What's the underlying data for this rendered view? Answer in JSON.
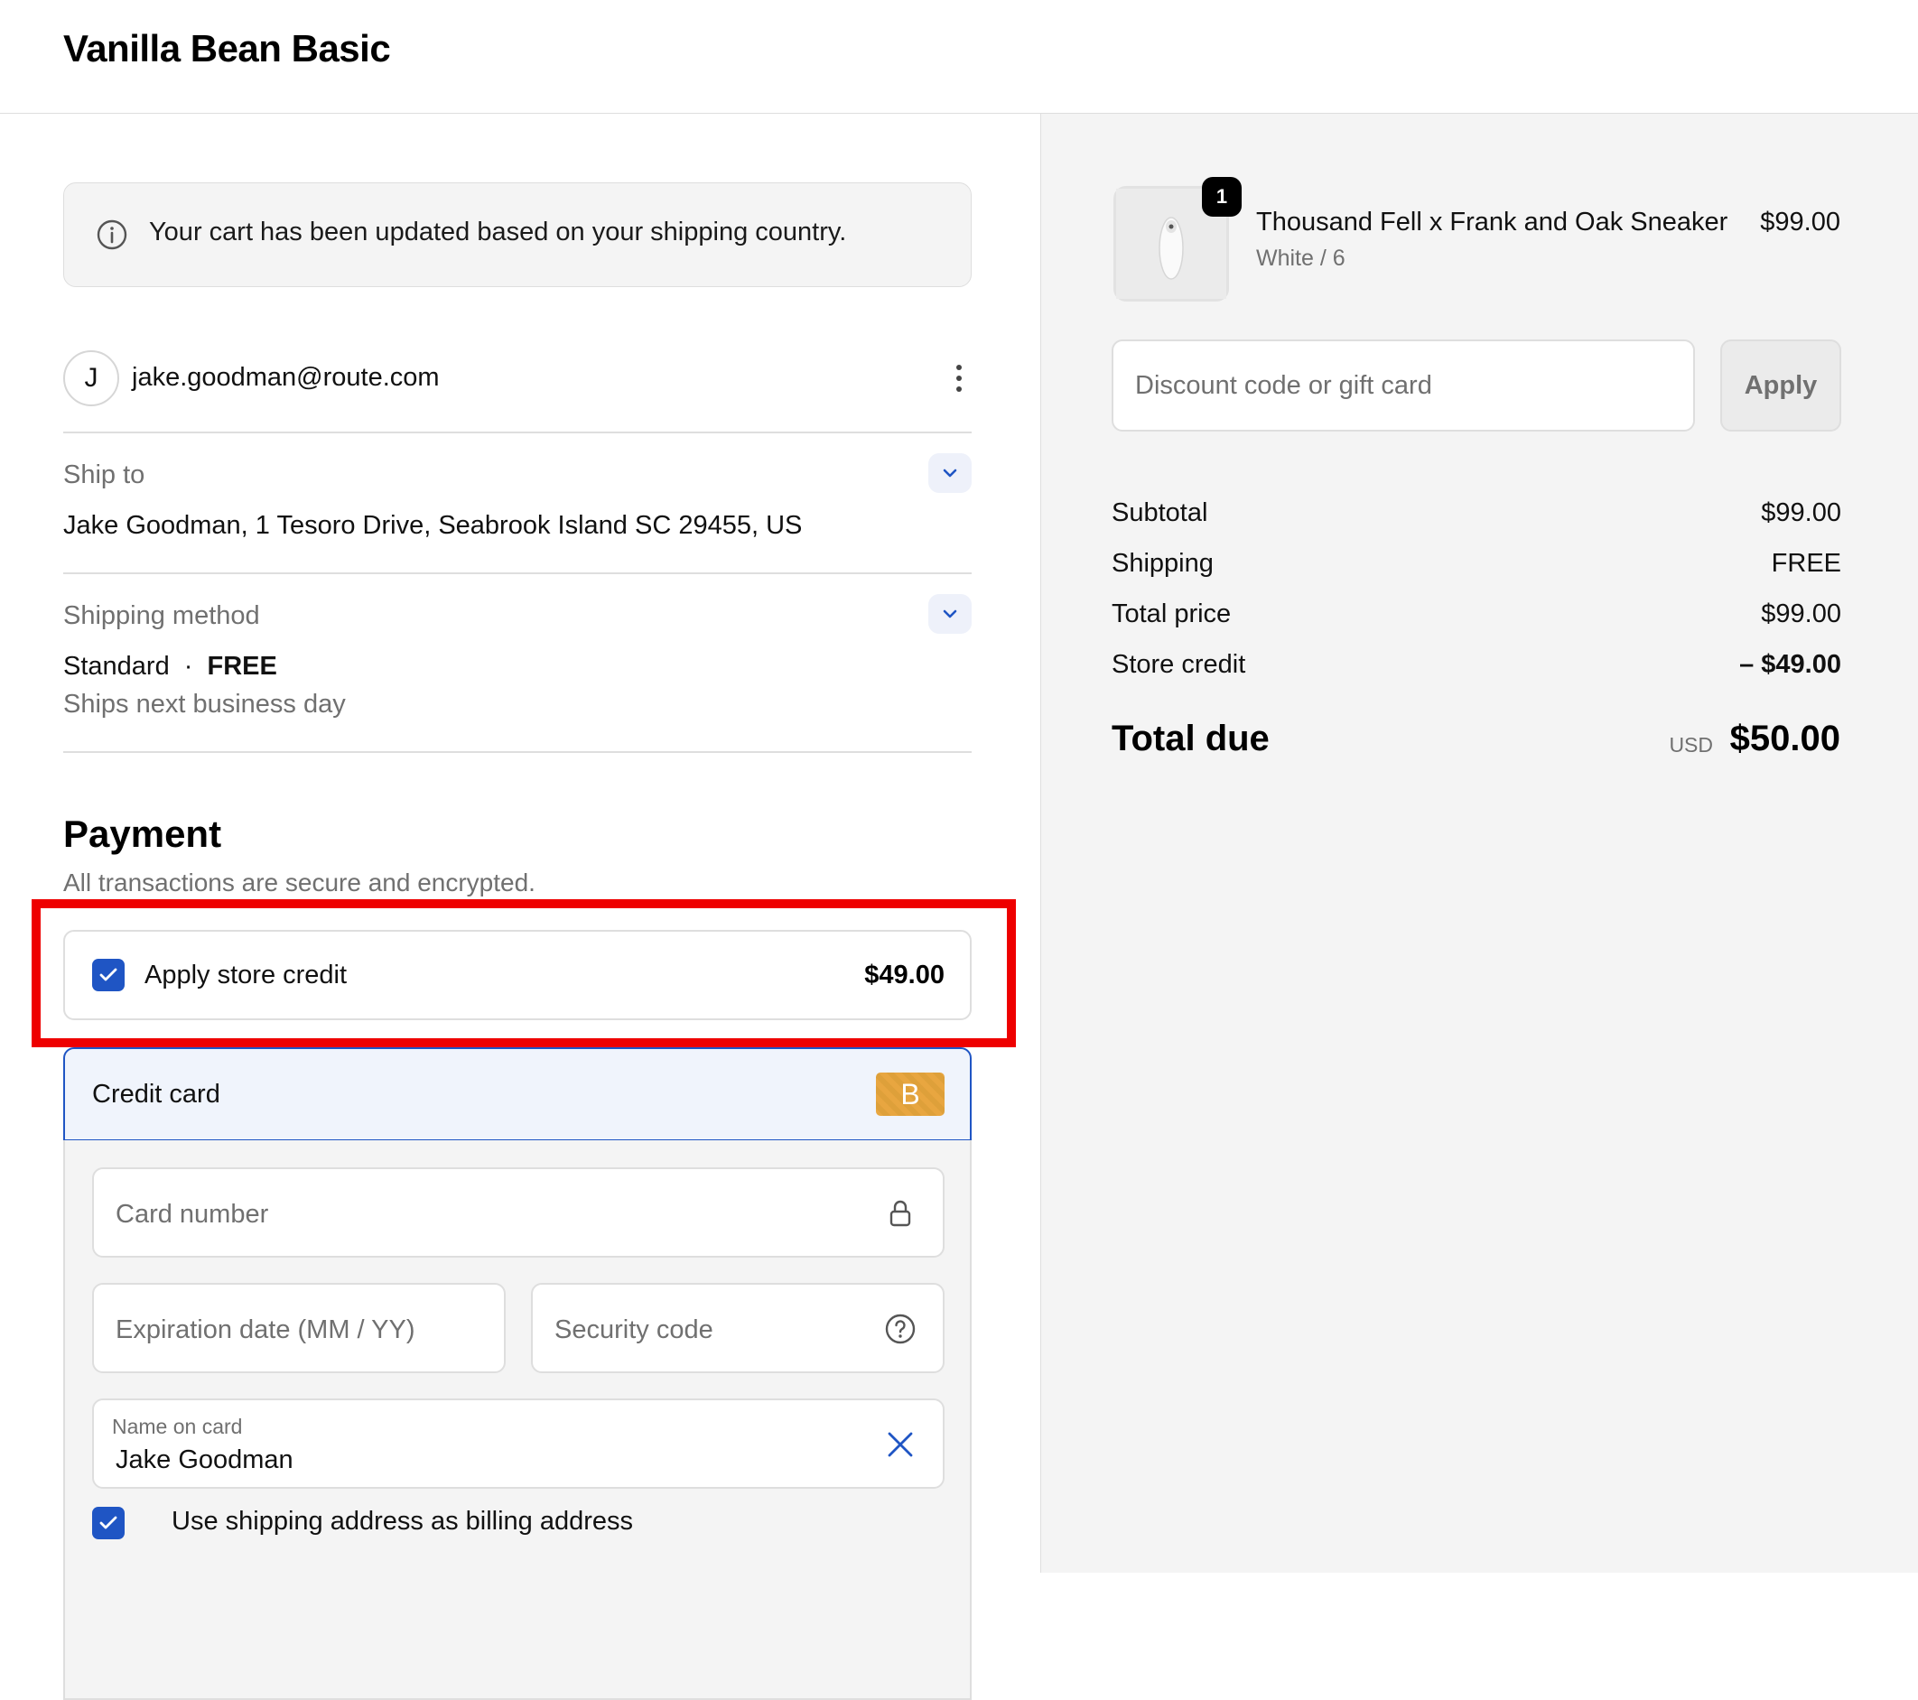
{
  "header": {
    "store_name": "Vanilla Bean Basic"
  },
  "notice": {
    "text": "Your cart has been updated based on your shipping country."
  },
  "contact": {
    "avatar_initial": "J",
    "email": "jake.goodman@route.com"
  },
  "ship_to": {
    "label": "Ship to",
    "value": "Jake Goodman, 1 Tesoro Drive, Seabrook Island SC 29455, US"
  },
  "shipping_method": {
    "label": "Shipping method",
    "name": "Standard",
    "separator": "·",
    "price": "FREE",
    "sub": "Ships next business day"
  },
  "payment": {
    "title": "Payment",
    "subtitle": "All transactions are secure and encrypted.",
    "store_credit": {
      "label": "Apply store credit",
      "amount": "$49.00",
      "checked": true
    },
    "credit_card": {
      "label": "Credit card",
      "badge": "B",
      "card_number_placeholder": "Card number",
      "expiration_placeholder": "Expiration date (MM / YY)",
      "security_placeholder": "Security code",
      "name_label": "Name on card",
      "name_value": "Jake Goodman"
    },
    "billing_checkbox_label": "Use shipping address as billing address"
  },
  "summary": {
    "product": {
      "quantity": "1",
      "name": "Thousand Fell x Frank and Oak Sneaker",
      "variant": "White / 6",
      "price": "$99.00"
    },
    "discount_placeholder": "Discount code or gift card",
    "apply_label": "Apply",
    "rows": [
      {
        "label": "Subtotal",
        "value": "$99.00"
      },
      {
        "label": "Shipping",
        "value": "FREE"
      },
      {
        "label": "Total price",
        "value": "$99.00"
      },
      {
        "label": "Store credit",
        "value": "– $49.00"
      }
    ],
    "total_label": "Total due",
    "currency": "USD",
    "total_value": "$50.00"
  },
  "colors": {
    "accent": "#1f55c4",
    "highlight": "#ee0000",
    "sidebar_bg": "#f4f4f4"
  }
}
